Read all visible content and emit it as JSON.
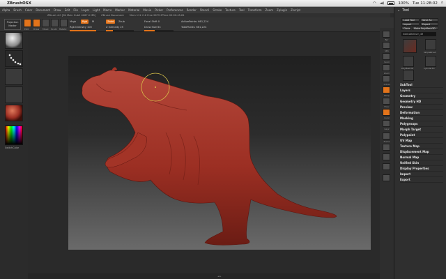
{
  "macbar": {
    "app_name": "ZBrushOSX",
    "right_items": [
      "100%",
      "Tue 11:28:02"
    ]
  },
  "appmenu": {
    "items": [
      "Alpha",
      "Brush",
      "Color",
      "Document",
      "Draw",
      "Edit",
      "File",
      "Layer",
      "Light",
      "Macro",
      "Marker",
      "Material",
      "Movie",
      "Picker",
      "Preferences",
      "Render",
      "Stencil",
      "Stroke",
      "Texture",
      "Tool",
      "Transform",
      "Zoom",
      "Zplugin",
      "Zscript"
    ],
    "menus_label": "Menus",
    "default_zscript": "DefaultZScript"
  },
  "status": {
    "items": [
      "ZBrush 4.0 [Stl Main Hub2 4267.0 MB]",
      "ZBrush Document",
      "Mem 111+16  Free 2679  ZTime 00:00:45.81"
    ]
  },
  "toolbar": {
    "projection_master_line1": "Projection",
    "projection_master_line2": "Master",
    "icon_labels": [
      "Edit",
      "Draw",
      "Move",
      "Scale",
      "Rotate"
    ],
    "mrgb": "Mrgb",
    "rgb": "Rgb",
    "m": "M",
    "zadd": "Zadd",
    "zsub": "Zsub",
    "rgb_intensity": "Rgb Intensity 100",
    "z_intensity": "Z Intensity 25",
    "focal_shift": "Focal Shift 0",
    "draw_size": "Draw Size 64",
    "active_points": "ActivePoints: 661,224",
    "total_points": "TotalPoints: 661,224",
    "rgb_intensity_fill": 1.0,
    "z_intensity_fill": 0.25,
    "draw_size_fill": 0.35
  },
  "leftshelf": {
    "switch_color": "SwitchColor"
  },
  "rstrip": {
    "labels": [
      "Bpr",
      "SPix",
      "Scroll",
      "Zoom",
      "Actual",
      "AAHalf",
      "Persp",
      "Floor",
      "Local",
      "LSym",
      "Gxyz",
      "Frame",
      "Move",
      "Scale",
      "Rotate",
      "PolyF",
      "Transp",
      "Dynamic",
      "Solo"
    ]
  },
  "palette": {
    "title": "Tool",
    "load_tool": "Load Tool",
    "save_as": "Save As",
    "import": "Import",
    "export": "Export",
    "clone": "Clone",
    "make_polymesh": "Make PolyMesh3D",
    "goz": "GoZ",
    "all": "All",
    "visible": "Visible",
    "r": "R",
    "current_tool": "Indricotherium_49",
    "tools": [
      {
        "name": "SimpleBrush"
      },
      {
        "name": "Cylinder3D"
      },
      {
        "name": "PolyMesh3D"
      },
      {
        "name": "SphereS"
      }
    ],
    "subpalettes": [
      "SubTool",
      "Layers",
      "Geometry",
      "Geometry HD",
      "Preview",
      "Deformation",
      "Masking",
      "Polygroups",
      "Morph Target",
      "Polypaint",
      "UV Map",
      "Texture Map",
      "Displacement Map",
      "Normal Map",
      "Unified Skin",
      "Display Properties",
      "Import",
      "Export"
    ]
  },
  "colors": {
    "accent": "#e3741b",
    "model": "#9c2f23",
    "panel": "#2f2f2f"
  }
}
